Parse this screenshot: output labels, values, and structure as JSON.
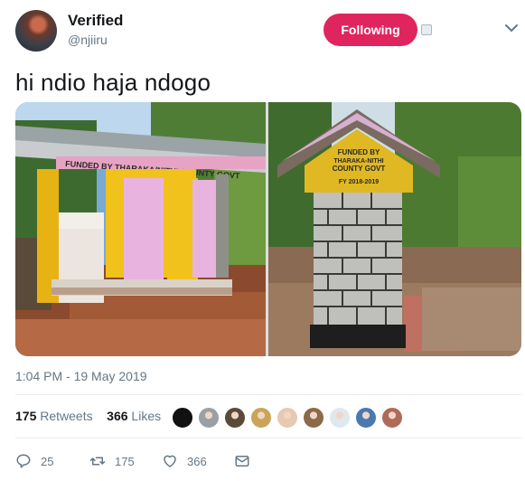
{
  "colors": {
    "follow_bg": "#e0245e",
    "text_primary": "#14171a",
    "text_secondary": "#657786",
    "icon": "#657786"
  },
  "user": {
    "name": "Verified",
    "handle": "@njiiru"
  },
  "header": {
    "follow_label": "Following"
  },
  "tweet": {
    "text": "hi ndio haja ndogo",
    "timestamp": "1:04 PM - 19 May 2019",
    "photos": {
      "left_sign": "FUNDED BY THARAKA/NITHI COUNTY GOVT",
      "right_sign": [
        "FUNDED BY",
        "THARAKA-NITHI",
        "COUNTY GOVT",
        "FY 2018-2019"
      ]
    }
  },
  "stats": {
    "retweets_count": "175",
    "retweets_label": "Retweets",
    "likes_count": "366",
    "likes_label": "Likes"
  },
  "likers": [
    {
      "icon": "avatar-black",
      "color": "#111111"
    },
    {
      "icon": "avatar-sketch",
      "color": "#9aa0a6"
    },
    {
      "icon": "avatar-person",
      "color": "#5b4a3a"
    },
    {
      "icon": "avatar-person",
      "color": "#c9a55a"
    },
    {
      "icon": "avatar-person",
      "color": "#e7c9b1"
    },
    {
      "icon": "avatar-person",
      "color": "#8a6a4a"
    },
    {
      "icon": "avatar-cartoon",
      "color": "#dfe8ef"
    },
    {
      "icon": "avatar-person",
      "color": "#4a78b0"
    },
    {
      "icon": "avatar-person",
      "color": "#b06a5a"
    }
  ],
  "actions": {
    "reply_count": "25",
    "retweet_count": "175",
    "like_count": "366"
  }
}
